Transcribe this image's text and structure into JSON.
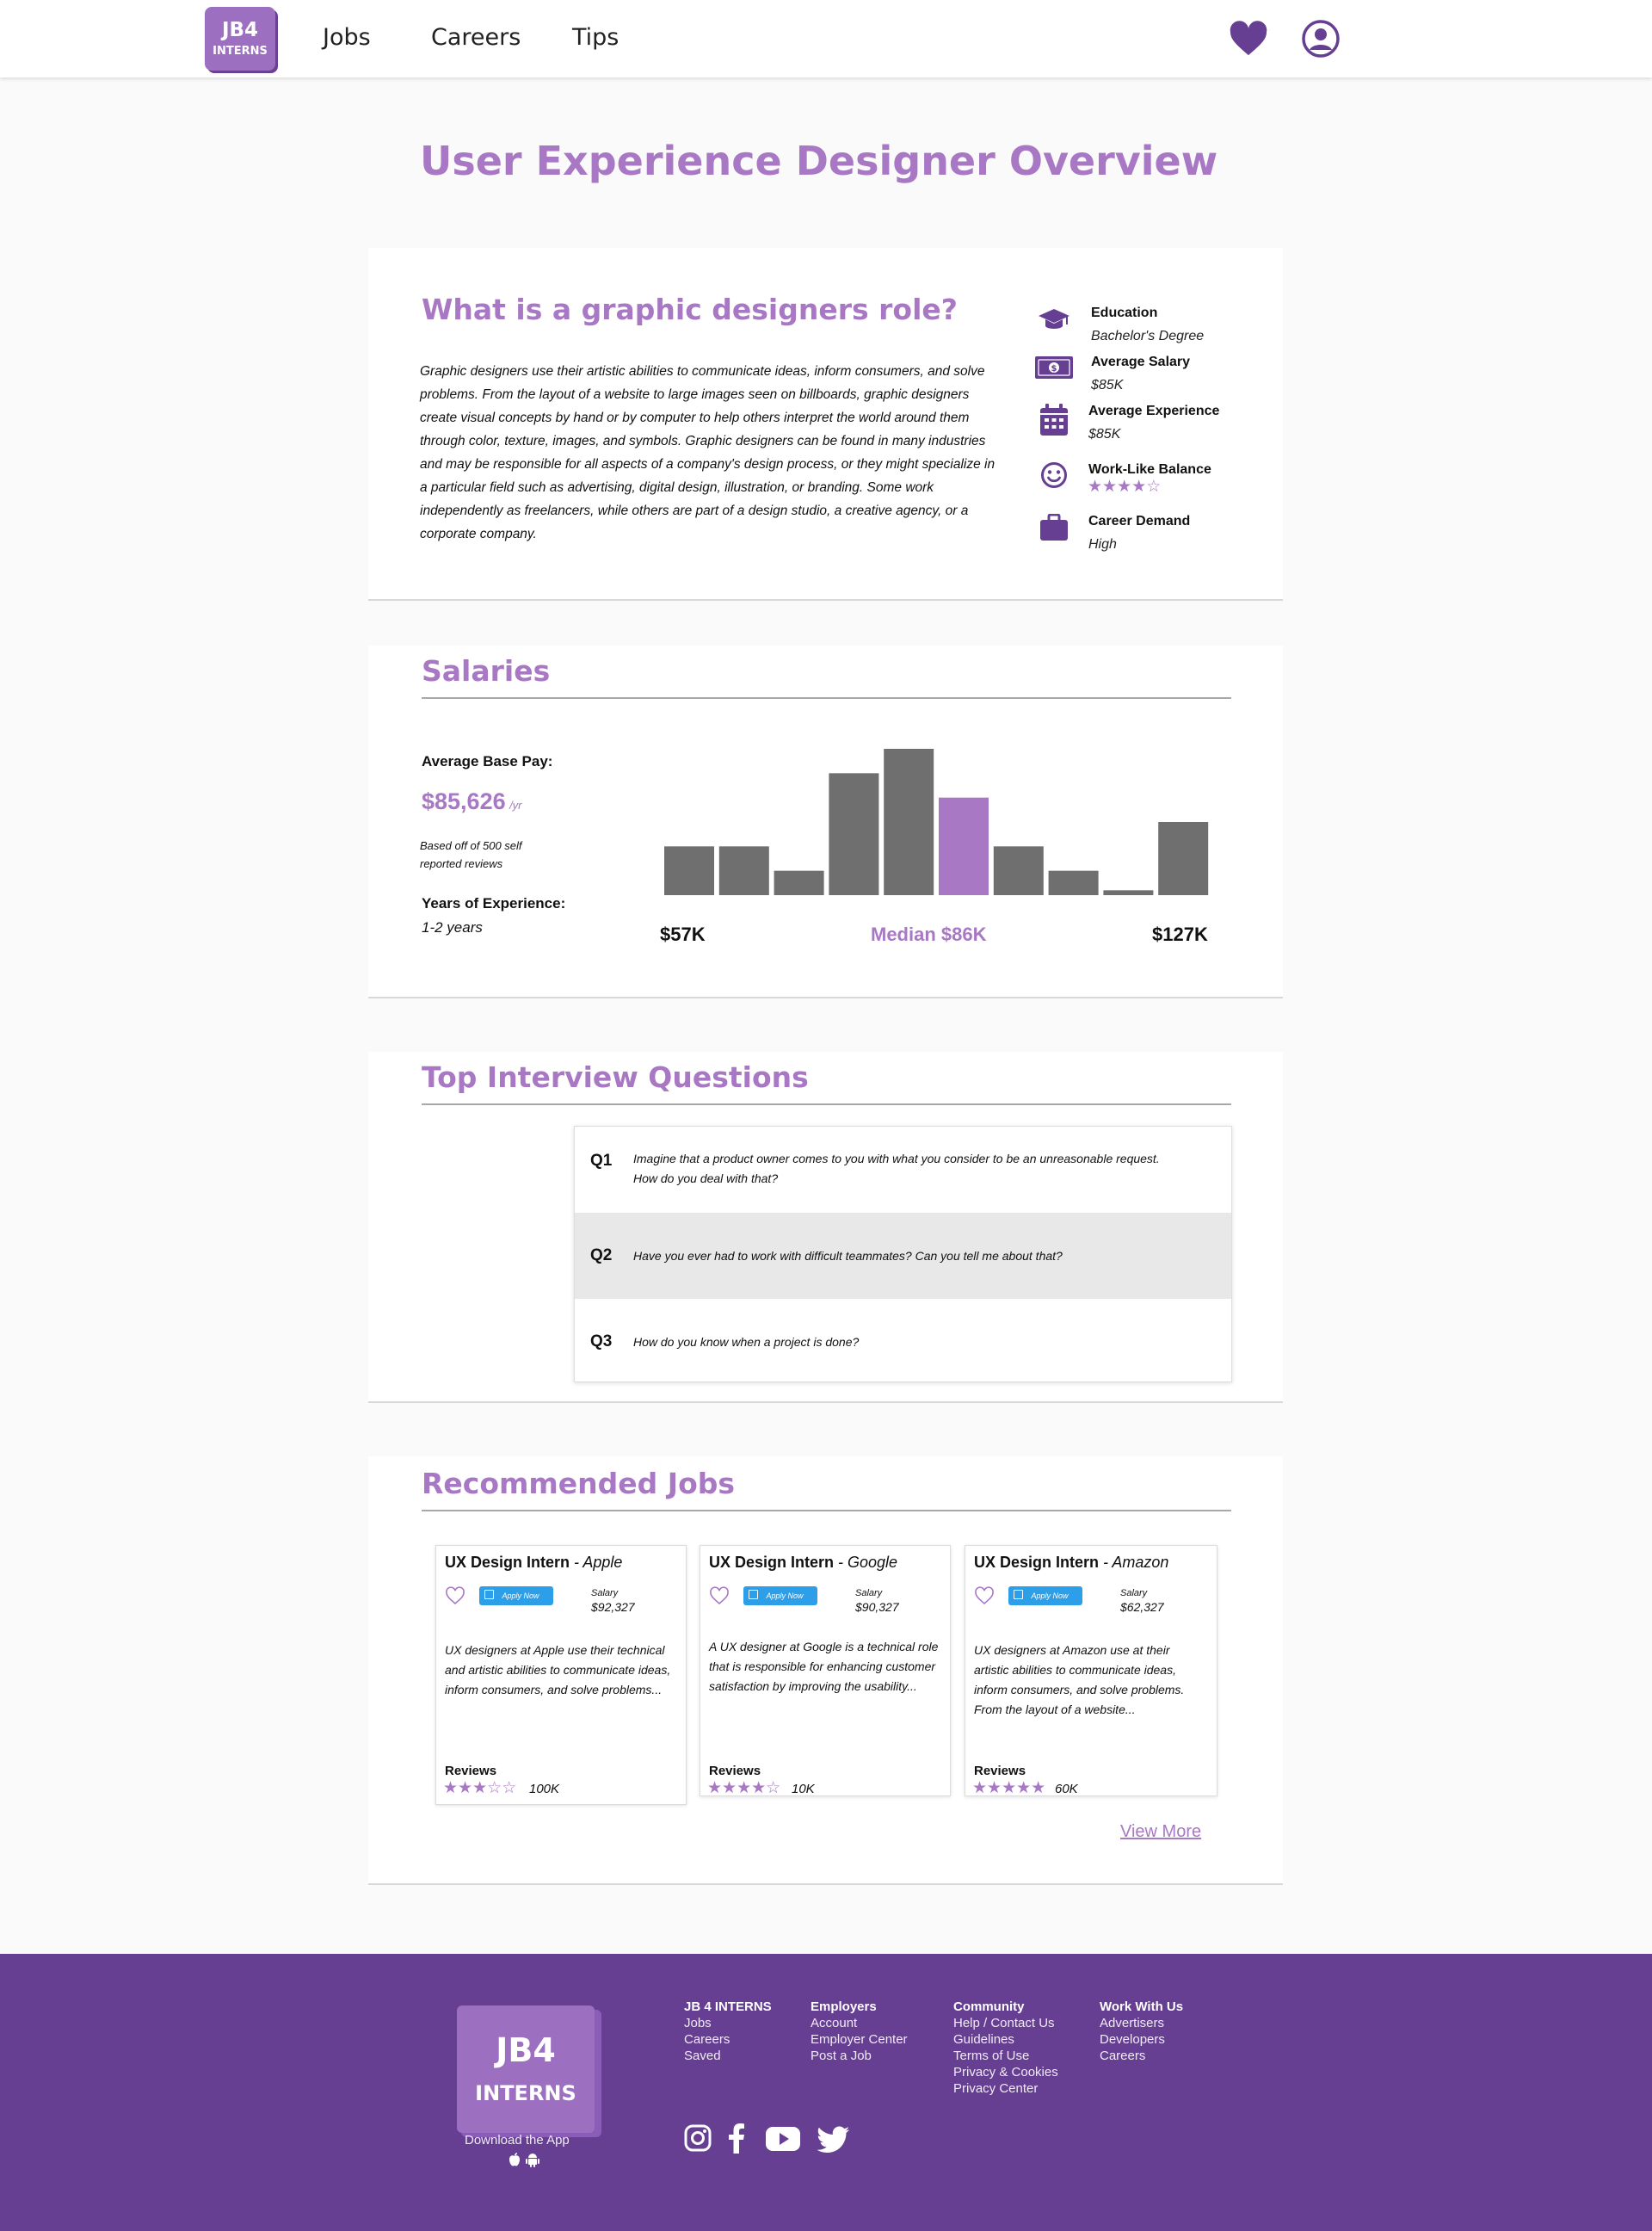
{
  "header": {
    "logo_line1": "JB4",
    "logo_line2": "INTERNS",
    "nav": [
      "Jobs",
      "Careers",
      "Tips"
    ]
  },
  "page_title": "User Experience Designer Overview",
  "role": {
    "title": "What is a graphic designers role?",
    "description": "Graphic designers use their artistic abilities to communicate ideas, inform consumers, and solve problems. From the layout of a website to large images seen on billboards, graphic designers create visual concepts by hand or by computer to help others interpret the world around them through color, texture, images, and symbols. Graphic designers can be found in many industries and may be responsible for all aspects of a company's design process, or they might specialize in a particular field such as advertising, digital design, illustration, or branding. Some work independently as freelancers, while others are part of a design studio, a creative agency, or a corporate company.",
    "stats": [
      {
        "label": "Education",
        "value": "Bachelor's Degree",
        "icon": "graduation-cap-icon"
      },
      {
        "label": "Average Salary",
        "value": "$85K",
        "icon": "money-bill-icon"
      },
      {
        "label": "Average Experience",
        "value": "$85K",
        "icon": "calendar-icon"
      },
      {
        "label": "Work-Like Balance",
        "rating": 4,
        "rating_max": 5,
        "icon": "smiley-icon"
      },
      {
        "label": "Career Demand",
        "value": "High",
        "icon": "briefcase-icon"
      }
    ]
  },
  "salaries": {
    "title": "Salaries",
    "avg_label": "Average Base Pay:",
    "avg_value": "$85,626",
    "avg_unit": "/yr",
    "basis_line1": "Based off of 500 self",
    "basis_line2": "reported reviews",
    "exp_label": "Years of Experience:",
    "exp_value": "1-2 years",
    "min_label": "$57K",
    "median_label": "Median $86K",
    "max_label": "$127K",
    "highlight_color": "#a878c4",
    "bar_color": "#6f6f6f"
  },
  "chart_data": {
    "type": "bar",
    "values": [
      20,
      20,
      10,
      50,
      60,
      40,
      20,
      10,
      2,
      30
    ],
    "highlight_index": 5,
    "x_labels": {
      "min": "$57K",
      "median": "Median $86K",
      "max": "$127K"
    }
  },
  "interview": {
    "title": "Top Interview Questions",
    "questions": [
      {
        "num": "Q1",
        "text": "Imagine that a product owner comes to you with what you consider to be an unreasonable request. How do you deal with that?"
      },
      {
        "num": "Q2",
        "text": "Have you ever had to work with difficult teammates? Can you tell me about that?"
      },
      {
        "num": "Q3",
        "text": "How do you know when a project is done?"
      }
    ]
  },
  "jobs": {
    "title": "Recommended Jobs",
    "apply_label": "Apply Now",
    "salary_label": "Salary",
    "reviews_label": "Reviews",
    "view_more": "View More",
    "items": [
      {
        "title": "UX Design Intern",
        "company": " - Apple",
        "salary": "$92,327",
        "desc": "UX designers at Apple use their technical and artistic abilities to communicate ideas, inform consumers, and solve problems...",
        "rating": 3,
        "reviews": "100K"
      },
      {
        "title": "UX Design Intern",
        "company": " - Google",
        "salary": "$90,327",
        "desc": "A UX designer at Google is a technical role that is responsible for enhancing customer satisfaction by improving the usability...",
        "rating": 4,
        "reviews": "10K"
      },
      {
        "title": "UX Design Intern",
        "company": " - Amazon",
        "salary": "$62,327",
        "desc": "UX designers at Amazon use at their artistic abilities to communicate ideas, inform consumers, and solve problems. From the layout of a website...",
        "rating": 5,
        "reviews": "60K"
      }
    ]
  },
  "footer": {
    "logo_line1": "JB4",
    "logo_line2": "INTERNS",
    "download": "Download the App",
    "columns": [
      {
        "head": "JB 4 INTERNS",
        "links": [
          "Jobs",
          "Careers",
          "Saved"
        ]
      },
      {
        "head": "Employers",
        "links": [
          "Account",
          "Employer Center",
          "Post a Job"
        ]
      },
      {
        "head": "Community",
        "links": [
          "Help / Contact Us",
          "Guidelines",
          "Terms of Use",
          "Privacy & Cookies",
          "Privacy Center"
        ]
      },
      {
        "head": "Work With Us",
        "links": [
          "Advertisers",
          "Developers",
          "Careers"
        ]
      }
    ],
    "social": [
      "instagram-icon",
      "facebook-icon",
      "youtube-icon",
      "twitter-icon"
    ]
  }
}
